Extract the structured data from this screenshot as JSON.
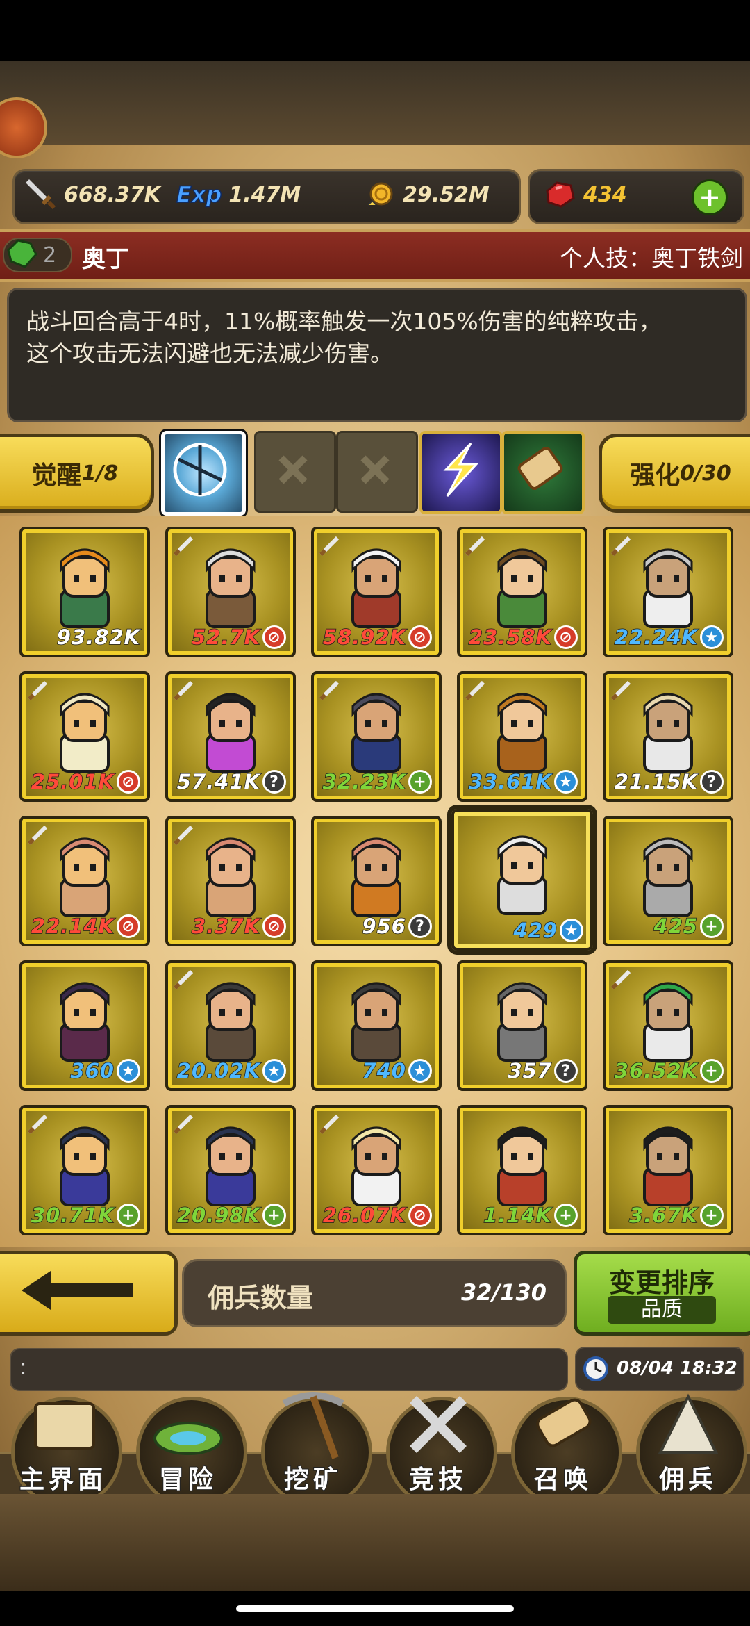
{
  "resources": {
    "attack": "668.37K",
    "exp_label": "Exp",
    "exp": "1.47M",
    "gold": "29.52M",
    "gems": "434"
  },
  "hero": {
    "level": "2",
    "name": "奥丁",
    "skill_title": "个人技：奥丁铁剑",
    "description_line1": "战斗回合高于4时，11%概率触发一次105%伤害的纯粹攻击，",
    "description_line2": "这个攻击无法闪避也无法减少伤害。"
  },
  "awaken": {
    "label": "觉醒",
    "value": "1/8"
  },
  "enhance": {
    "label": "强化",
    "value": "0/30"
  },
  "cards": [
    {
      "value": "93.82K",
      "badge": "none",
      "color": "#ffffff",
      "sword": false
    },
    {
      "value": "52.7K",
      "badge": "red",
      "color": "#ff4a3a",
      "sword": true
    },
    {
      "value": "58.92K",
      "badge": "red",
      "color": "#ff4a3a",
      "sword": true
    },
    {
      "value": "23.58K",
      "badge": "red",
      "color": "#ff4a3a",
      "sword": true
    },
    {
      "value": "22.24K",
      "badge": "blue",
      "color": "#4fb8ff",
      "sword": true
    },
    {
      "value": "25.01K",
      "badge": "red",
      "color": "#ff4a3a",
      "sword": true
    },
    {
      "value": "57.41K",
      "badge": "?",
      "color": "#ffffff",
      "sword": true
    },
    {
      "value": "32.23K",
      "badge": "green",
      "color": "#7fd63a",
      "sword": true
    },
    {
      "value": "33.61K",
      "badge": "blue",
      "color": "#4fb8ff",
      "sword": true
    },
    {
      "value": "21.15K",
      "badge": "?",
      "color": "#ffffff",
      "sword": true
    },
    {
      "value": "22.14K",
      "badge": "red",
      "color": "#ff4a3a",
      "sword": true
    },
    {
      "value": "3.37K",
      "badge": "red",
      "color": "#ff4a3a",
      "sword": true
    },
    {
      "value": "956",
      "badge": "?",
      "color": "#ffffff",
      "sword": false
    },
    {
      "value": "429",
      "badge": "blue",
      "color": "#4fb8ff",
      "sword": false
    },
    {
      "value": "425",
      "badge": "green",
      "color": "#7fd63a",
      "sword": false
    },
    {
      "value": "360",
      "badge": "blue",
      "color": "#4fb8ff",
      "sword": false
    },
    {
      "value": "20.02K",
      "badge": "blue",
      "color": "#4fb8ff",
      "sword": true
    },
    {
      "value": "740",
      "badge": "blue",
      "color": "#4fb8ff",
      "sword": false
    },
    {
      "value": "357",
      "badge": "?",
      "color": "#ffffff",
      "sword": false
    },
    {
      "value": "36.52K",
      "badge": "green",
      "color": "#7fd63a",
      "sword": true
    },
    {
      "value": "30.71K",
      "badge": "green",
      "color": "#7fd63a",
      "sword": true
    },
    {
      "value": "20.98K",
      "badge": "green",
      "color": "#7fd63a",
      "sword": true
    },
    {
      "value": "26.07K",
      "badge": "red",
      "color": "#ff4a3a",
      "sword": true
    },
    {
      "value": "1.14K",
      "badge": "green",
      "color": "#7fd63a",
      "sword": false
    },
    {
      "value": "3.67K",
      "badge": "green",
      "color": "#7fd63a",
      "sword": false
    }
  ],
  "mercenary_count": {
    "label": "佣兵数量",
    "value": "32/130"
  },
  "sort": {
    "label": "变更排序",
    "mode": "品质"
  },
  "message_text": ":",
  "clock": "08/04 18:32",
  "nav": [
    {
      "label": "主界面",
      "icon": "map-scroll-icon"
    },
    {
      "label": "冒险",
      "icon": "island-icon"
    },
    {
      "label": "挖矿",
      "icon": "pickaxe-icon"
    },
    {
      "label": "竞技",
      "icon": "crossed-swords-icon"
    },
    {
      "label": "召唤",
      "icon": "summon-scroll-icon"
    },
    {
      "label": "佣兵",
      "icon": "tent-icon"
    }
  ]
}
